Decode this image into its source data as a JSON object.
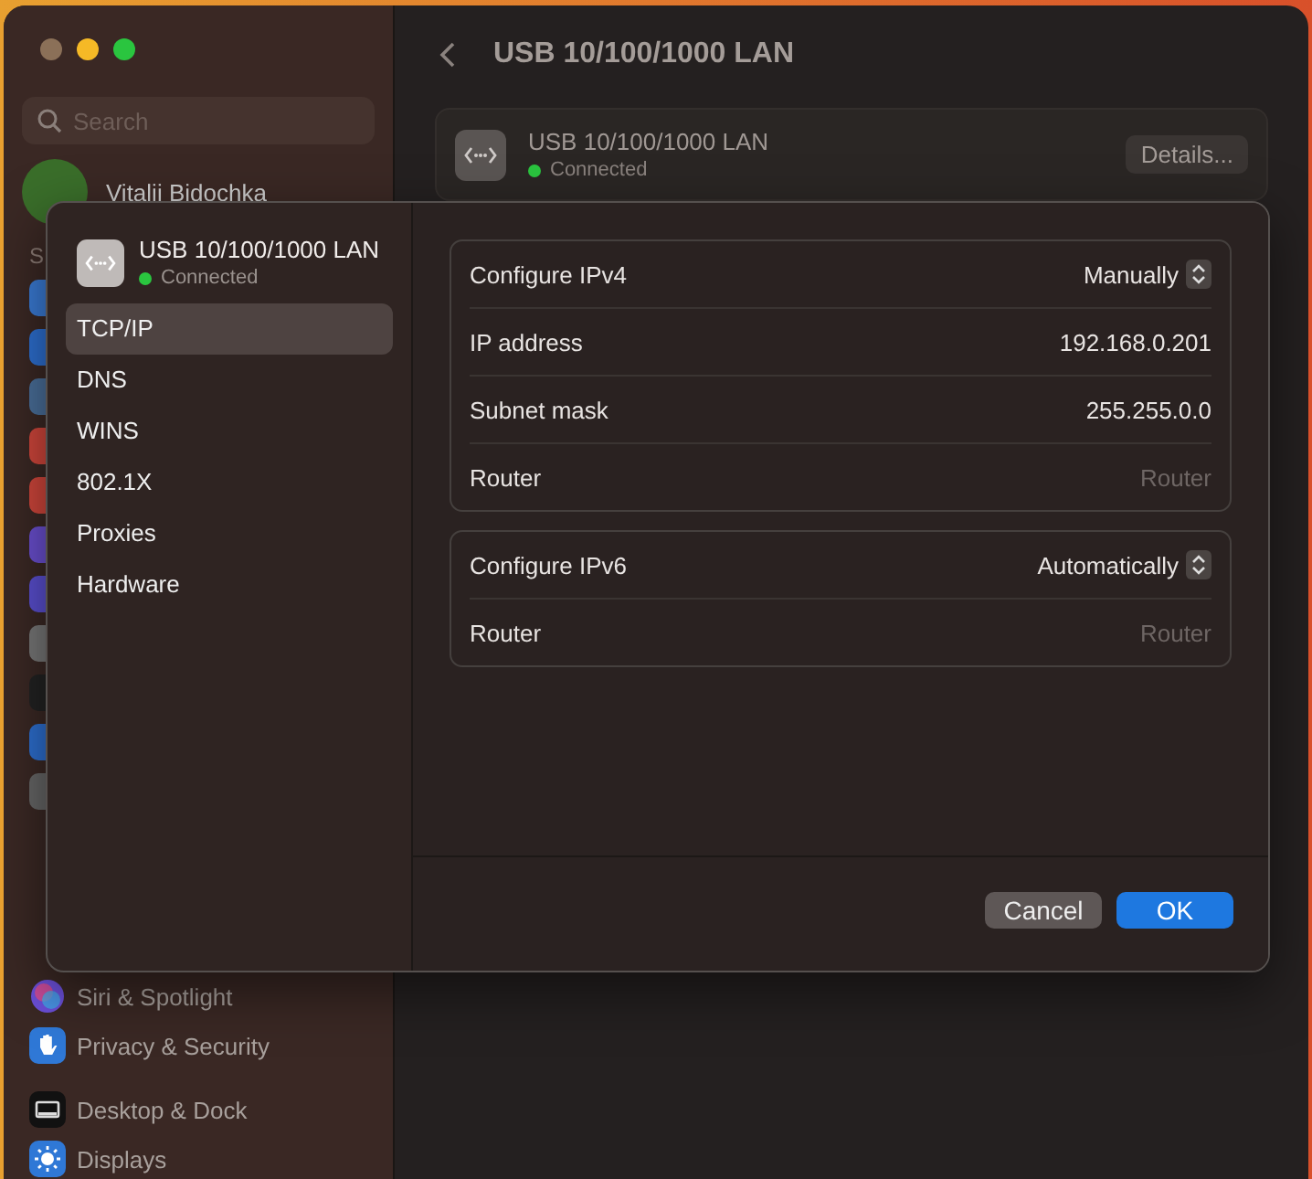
{
  "sidebar": {
    "search": {
      "placeholder": "Search"
    },
    "user": {
      "name": "Vitalii Bidochka"
    },
    "section_header": "S",
    "items": [
      {
        "label": "Siri & Spotlight",
        "kind": "siri"
      },
      {
        "label": "Privacy & Security",
        "kind": "hand"
      },
      {
        "label": "Desktop & Dock",
        "kind": "dock"
      },
      {
        "label": "Displays",
        "kind": "sun"
      }
    ]
  },
  "header": {
    "title": "USB 10/100/1000 LAN"
  },
  "device_card": {
    "name": "USB 10/100/1000 LAN",
    "status": "Connected",
    "connected": true,
    "details_button": "Details..."
  },
  "sheet": {
    "device": {
      "name": "USB 10/100/1000 LAN",
      "status": "Connected",
      "connected": true
    },
    "tabs": [
      {
        "label": "TCP/IP",
        "selected": true
      },
      {
        "label": "DNS",
        "selected": false
      },
      {
        "label": "WINS",
        "selected": false
      },
      {
        "label": "802.1X",
        "selected": false
      },
      {
        "label": "Proxies",
        "selected": false
      },
      {
        "label": "Hardware",
        "selected": false
      }
    ],
    "groups": [
      {
        "rows": [
          {
            "label": "Configure IPv4",
            "kind": "popup",
            "value": "Manually"
          },
          {
            "label": "IP address",
            "kind": "text",
            "value": "192.168.0.201"
          },
          {
            "label": "Subnet mask",
            "kind": "text",
            "value": "255.255.0.0"
          },
          {
            "label": "Router",
            "kind": "field",
            "placeholder": "Router"
          }
        ]
      },
      {
        "rows": [
          {
            "label": "Configure IPv6",
            "kind": "popup",
            "value": "Automatically"
          },
          {
            "label": "Router",
            "kind": "field",
            "placeholder": "Router"
          }
        ]
      }
    ],
    "buttons": [
      {
        "label": "Cancel",
        "kind": "secondary"
      },
      {
        "label": "OK",
        "kind": "primary"
      }
    ]
  }
}
